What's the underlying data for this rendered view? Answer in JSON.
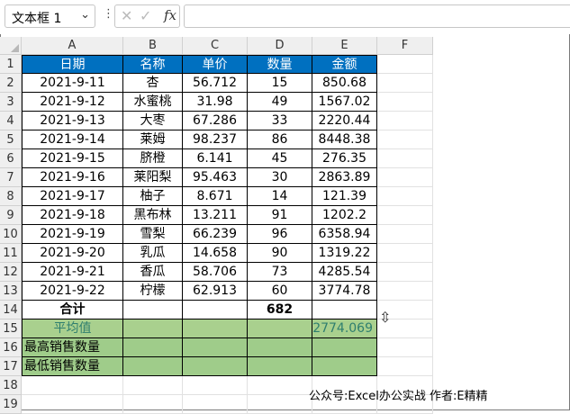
{
  "name_box": {
    "value": "文本框 1",
    "arrow": "⌄"
  },
  "formula_bar": {
    "cancel": "✕",
    "enter": "✓",
    "fx": "fx",
    "value": ""
  },
  "columns": [
    "A",
    "B",
    "C",
    "D",
    "E",
    "F"
  ],
  "rows": [
    "1",
    "2",
    "3",
    "4",
    "5",
    "6",
    "7",
    "8",
    "9",
    "10",
    "11",
    "12",
    "13",
    "14",
    "15",
    "16",
    "17",
    "18",
    "19"
  ],
  "table": {
    "headers": [
      "日期",
      "名称",
      "单价",
      "数量",
      "金额"
    ],
    "data": [
      [
        "2021-9-11",
        "杏",
        "56.712",
        "15",
        "850.68"
      ],
      [
        "2021-9-12",
        "水蜜桃",
        "31.98",
        "49",
        "1567.02"
      ],
      [
        "2021-9-13",
        "大枣",
        "67.286",
        "33",
        "2220.44"
      ],
      [
        "2021-9-14",
        "莱姆",
        "98.237",
        "86",
        "8448.38"
      ],
      [
        "2021-9-15",
        "脐橙",
        "6.141",
        "45",
        "276.35"
      ],
      [
        "2021-9-16",
        "莱阳梨",
        "95.463",
        "30",
        "2863.89"
      ],
      [
        "2021-9-17",
        "柚子",
        "8.671",
        "14",
        "121.39"
      ],
      [
        "2021-9-18",
        "黑布林",
        "13.211",
        "91",
        "1202.2"
      ],
      [
        "2021-9-19",
        "雪梨",
        "66.239",
        "96",
        "6358.94"
      ],
      [
        "2021-9-20",
        "乳瓜",
        "14.658",
        "90",
        "1319.22"
      ],
      [
        "2021-9-21",
        "香瓜",
        "58.706",
        "73",
        "4285.54"
      ],
      [
        "2021-9-22",
        "柠檬",
        "62.913",
        "60",
        "3774.78"
      ]
    ],
    "total_label": "合计",
    "total_qty": "682",
    "avg_label": "平均值",
    "avg_value": "2774.069",
    "max_label": "最高销售数量",
    "min_label": "最低销售数量"
  },
  "colors": {
    "header_fill": "#0070c0",
    "green_fill": "#a9d08e"
  },
  "footer_text": "公众号:Excel办公实战  作者:E精精"
}
